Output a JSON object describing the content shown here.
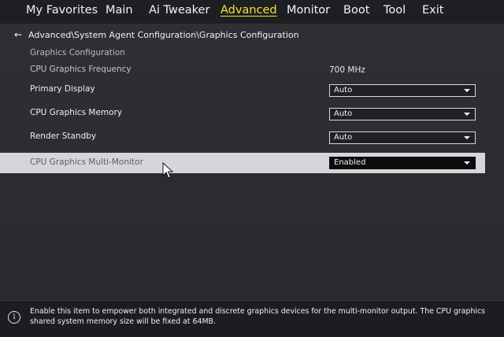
{
  "nav": {
    "tabs": [
      {
        "label": "My Favorites"
      },
      {
        "label": "Main"
      },
      {
        "label": "Ai Tweaker"
      },
      {
        "label": "Advanced"
      },
      {
        "label": "Monitor"
      },
      {
        "label": "Boot"
      },
      {
        "label": "Tool"
      },
      {
        "label": "Exit"
      }
    ],
    "active_tab": "Advanced"
  },
  "breadcrumb": {
    "back_icon": "arrow-left-icon",
    "path": "Advanced\\System Agent Configuration\\Graphics Configuration"
  },
  "section": {
    "title": "Graphics Configuration"
  },
  "settings": {
    "frequency": {
      "label": "CPU Graphics Frequency",
      "value": "700 MHz"
    },
    "primary_display": {
      "label": "Primary Display",
      "value": "Auto"
    },
    "graphics_memory": {
      "label": "CPU Graphics Memory",
      "value": "Auto"
    },
    "render_standby": {
      "label": "Render Standby",
      "value": "Auto"
    },
    "multi_monitor": {
      "label": "CPU Graphics Multi-Monitor",
      "value": "Enabled"
    }
  },
  "help": {
    "icon": "info-icon",
    "text": "Enable this item to empower both integrated and discrete graphics devices for the multi-monitor output. The CPU graphics shared system memory size will be fixed at 64MB."
  },
  "colors": {
    "active_tab": "#f5e23a",
    "highlight_row": "#d4d6da",
    "background": "#2b2d31"
  }
}
